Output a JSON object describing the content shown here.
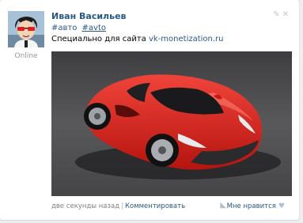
{
  "post": {
    "author": "Иван Васильев",
    "status": "Online",
    "tags": [
      "#авто",
      "#avto"
    ],
    "caption_text": "Специально для сайта ",
    "caption_link": "vk-monetization.ru",
    "time": "две секунды назад",
    "separator": "|",
    "comment_label": "Комментировать",
    "like_label": "Мне нравится",
    "icons": {
      "edit": "pencil-icon",
      "delete": "close-icon",
      "share": "megaphone-icon",
      "like": "heart-icon"
    }
  },
  "colors": {
    "link": "#2a5885",
    "muted": "#828282",
    "car": "#d8261e"
  }
}
